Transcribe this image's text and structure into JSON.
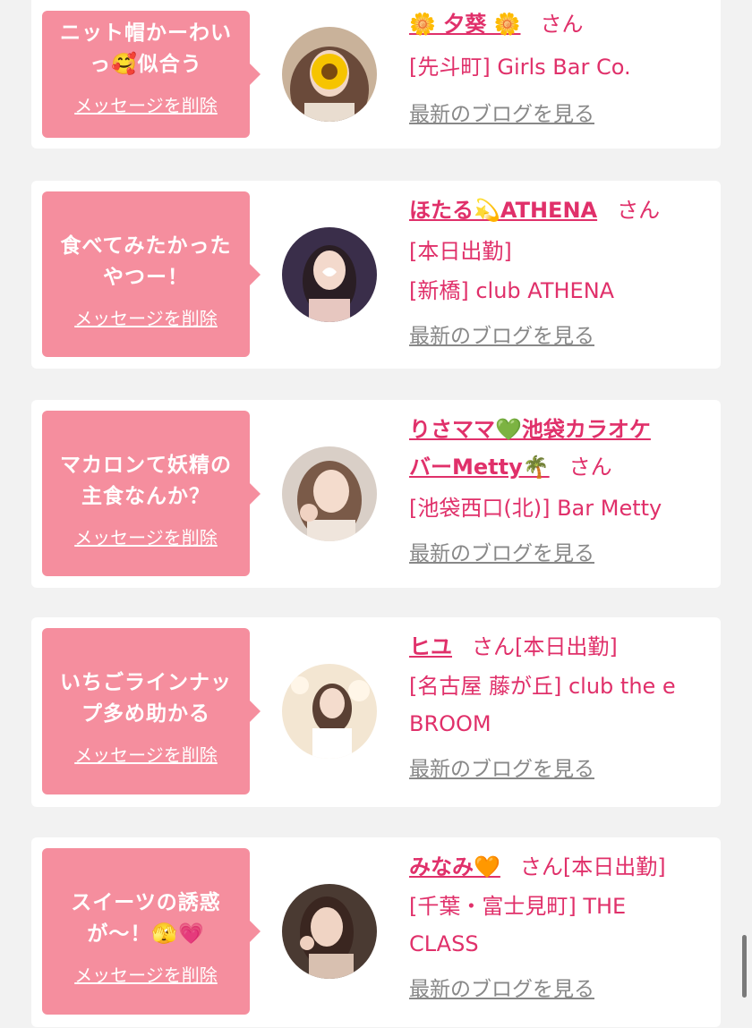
{
  "messages": [
    {
      "bubble_line1": "ニット帽かーわい",
      "bubble_line2": "っ🥰似合う",
      "delete_label": "メッセージを削除",
      "name": "🌼 夕葵 🌼",
      "san": "さん",
      "line1": "[先斗町] Girls Bar Co.",
      "blog_label": "最新のブログを見る"
    },
    {
      "bubble_line1": "食べてみたかった",
      "bubble_line2": "やつー！",
      "delete_label": "メッセージを削除",
      "name": "ほたる💫ATHENA",
      "san": "さん",
      "line1": "[本日出勤]",
      "line2": "[新橋] club ATHENA",
      "blog_label": "最新のブログを見る"
    },
    {
      "bubble_line1": "マカロンて妖精の",
      "bubble_line2": "主食なんか？",
      "delete_label": "メッセージを削除",
      "name_part1": "りさママ💚池袋カラオケ",
      "name_part2": "バーMetty🌴",
      "san": "さん",
      "line1": "[池袋西口(北)] Bar Metty",
      "blog_label": "最新のブログを見る"
    },
    {
      "bubble_line1": "いちごラインナッ",
      "bubble_line2": "プ多め助かる",
      "delete_label": "メッセージを削除",
      "name": "ヒユ",
      "san": "さん",
      "status": "[本日出勤]",
      "line1": "[名古屋 藤が丘] club the e",
      "line2": "BROOM",
      "blog_label": "最新のブログを見る"
    },
    {
      "bubble_line1": "スイーツの誘惑",
      "bubble_line2": "が〜！🫣💗",
      "delete_label": "メッセージを削除",
      "name": "みなみ🧡",
      "san": "さん",
      "status": "[本日出勤]",
      "line1": "[千葉・富士見町] THE",
      "line2": "CLASS",
      "blog_label": "最新のブログを見る"
    }
  ],
  "colors": {
    "accent": "#e0306a",
    "bubble": "#f58e9e",
    "background": "#f2f2f2",
    "link_gray": "#888888"
  }
}
